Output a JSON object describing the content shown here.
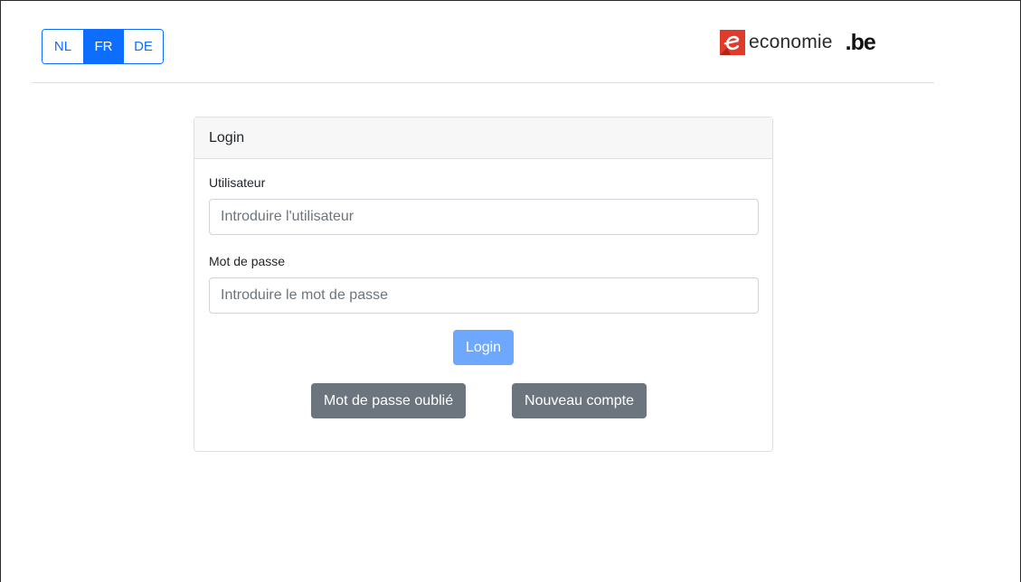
{
  "languages": {
    "items": [
      {
        "code": "NL",
        "label": "NL",
        "active": false
      },
      {
        "code": "FR",
        "label": "FR",
        "active": true
      },
      {
        "code": "DE",
        "label": "DE",
        "active": false
      }
    ]
  },
  "logo": {
    "icon": "economie-e-logo-icon",
    "text": "economie",
    "suffix": ".be",
    "brand_color": "#e03a2a"
  },
  "card": {
    "title": "Login",
    "username": {
      "label": "Utilisateur",
      "value": "",
      "placeholder": "Introduire l'utilisateur"
    },
    "password": {
      "label": "Mot de passe",
      "value": "",
      "placeholder": "Introduire le mot de passe"
    },
    "login_button": "Login",
    "forgot_button": "Mot de passe oublié",
    "new_account_button": "Nouveau compte"
  },
  "colors": {
    "primary": "#0d6efd",
    "primary_light": "#6ea8fe",
    "secondary": "#6c757d"
  }
}
